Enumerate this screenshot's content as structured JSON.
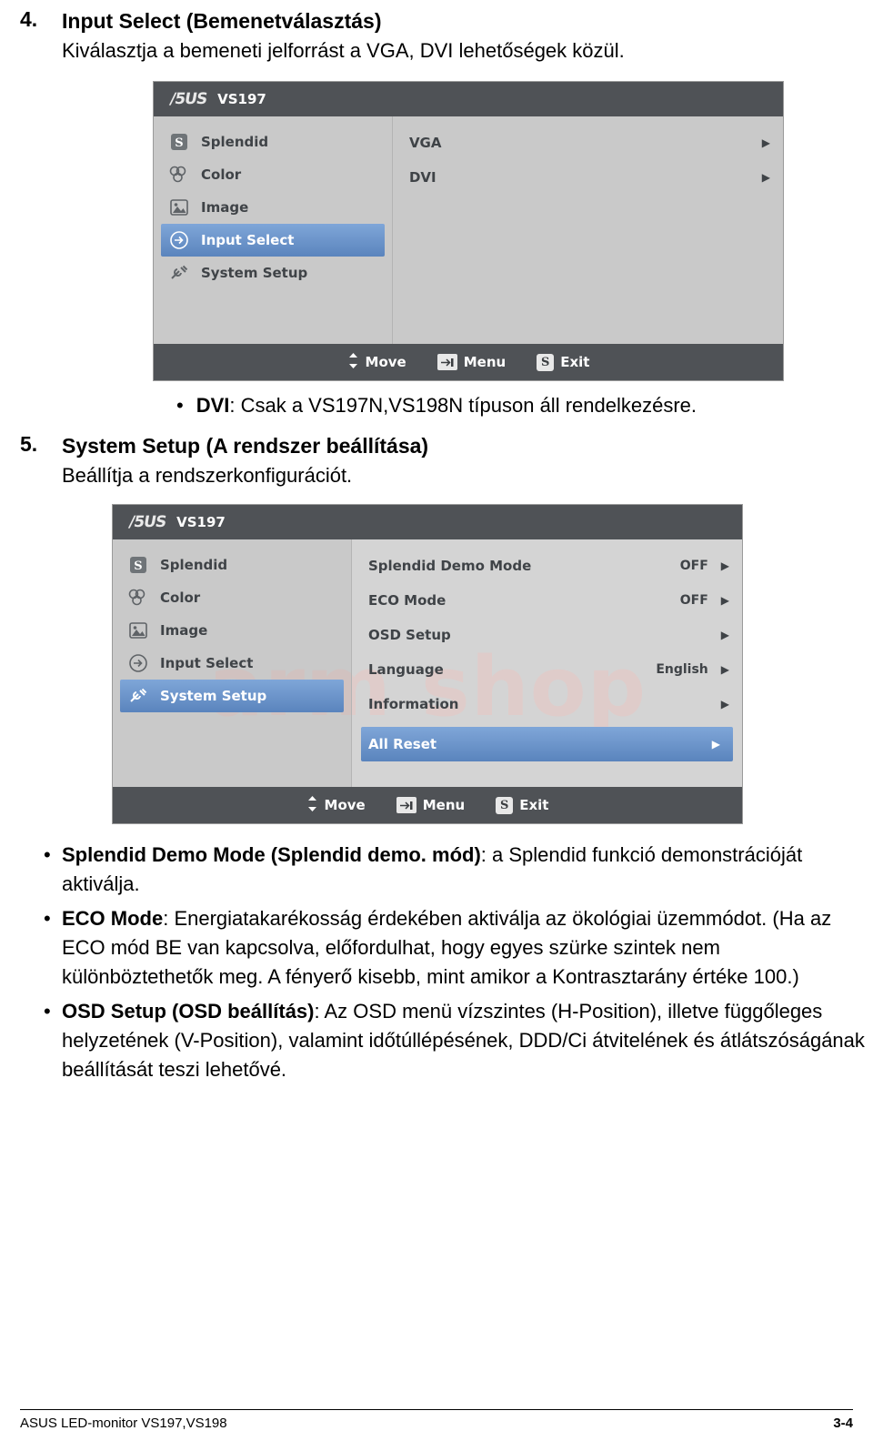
{
  "sections": [
    {
      "num": "4.",
      "title": "Input Select (Bemenetválasztás)",
      "desc": "Kiválasztja a bemeneti jelforrást a VGA, DVI lehetőségek közül."
    },
    {
      "num": "5.",
      "title": "System Setup (A rendszer beállítása)",
      "desc": "Beállítja a rendszerkonfigurációt."
    }
  ],
  "osd1": {
    "logo": "/5US",
    "model": "VS197",
    "menu": [
      {
        "label": "Splendid",
        "icon": "splendid-icon",
        "selected": false
      },
      {
        "label": "Color",
        "icon": "color-icon",
        "selected": false
      },
      {
        "label": "Image",
        "icon": "image-icon",
        "selected": false
      },
      {
        "label": "Input Select",
        "icon": "input-select-icon",
        "selected": true
      },
      {
        "label": "System Setup",
        "icon": "system-setup-icon",
        "selected": false
      }
    ],
    "rows": [
      {
        "label": "VGA",
        "value": "",
        "arrow": "▶",
        "selected": false
      },
      {
        "label": "DVI",
        "value": "",
        "arrow": "▶",
        "selected": false
      }
    ],
    "footer": [
      {
        "icon": "updown-arrows-icon",
        "label": "Move"
      },
      {
        "icon": "menu-icon",
        "label": "Menu"
      },
      {
        "icon": "s-badge-icon",
        "label": "Exit"
      }
    ]
  },
  "note1": {
    "bullet": "•",
    "bold": "DVI",
    "rest": ": Csak a VS197N,VS198N típuson áll rendelkezésre."
  },
  "osd2": {
    "logo": "/5US",
    "model": "VS197",
    "watermark": "arm shop",
    "menu": [
      {
        "label": "Splendid",
        "icon": "splendid-icon",
        "selected": false
      },
      {
        "label": "Color",
        "icon": "color-icon",
        "selected": false
      },
      {
        "label": "Image",
        "icon": "image-icon",
        "selected": false
      },
      {
        "label": "Input Select",
        "icon": "input-select-icon",
        "selected": false
      },
      {
        "label": "System Setup",
        "icon": "system-setup-icon",
        "selected": true
      }
    ],
    "rows": [
      {
        "label": "Splendid Demo Mode",
        "value": "OFF",
        "arrow": "▶",
        "selected": false
      },
      {
        "label": "ECO Mode",
        "value": "OFF",
        "arrow": "▶",
        "selected": false
      },
      {
        "label": "OSD Setup",
        "value": "",
        "arrow": "▶",
        "selected": false
      },
      {
        "label": "Language",
        "value": "English",
        "arrow": "▶",
        "selected": false
      },
      {
        "label": "Information",
        "value": "",
        "arrow": "▶",
        "selected": false
      },
      {
        "label": "All Reset",
        "value": "",
        "arrow": "▶",
        "selected": true
      }
    ],
    "footer": [
      {
        "icon": "updown-arrows-icon",
        "label": "Move"
      },
      {
        "icon": "menu-icon",
        "label": "Menu"
      },
      {
        "icon": "s-badge-icon",
        "label": "Exit"
      }
    ]
  },
  "bullets": [
    {
      "dot": "•",
      "bold": "Splendid Demo Mode (Splendid demo. mód)",
      "rest": ": a Splendid funkció demonstrációját aktiválja."
    },
    {
      "dot": "•",
      "bold": "ECO Mode",
      "rest": ": Energiatakarékosság érdekében aktiválja az ökológiai üzemmódot. (Ha az ECO mód BE van kapcsolva, előfordulhat, hogy egyes szürke szintek nem különböztethetők meg. A fényerő kisebb, mint amikor a Kontrasztarány értéke 100.)"
    },
    {
      "dot": "•",
      "bold": "OSD Setup (OSD beállítás)",
      "rest": ": Az OSD menü vízszintes (H-Position), illetve függőleges helyzetének (V-Position), valamint időtúllépésének, DDD/Ci átvitelének és átlátszóságának beállítását teszi lehetővé."
    }
  ],
  "footer": {
    "left": "ASUS LED-monitor VS197,VS198",
    "page": "3-4"
  }
}
